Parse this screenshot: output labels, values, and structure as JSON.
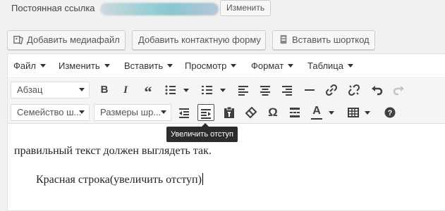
{
  "permalink": {
    "label": "Постоянная ссылка",
    "edit_button": "Изменить"
  },
  "media_buttons": [
    {
      "label": "Добавить медиафайл",
      "icon": "media-icon"
    },
    {
      "label": "Добавить контактную форму",
      "icon": "none"
    },
    {
      "label": "Вставить шорткод",
      "icon": "shortcode-icon"
    }
  ],
  "menubar": [
    "Файл",
    "Изменить",
    "Вставить",
    "Просмотр",
    "Формат",
    "Таблица"
  ],
  "toolbar1": {
    "format_select": "Абзац",
    "buttons": [
      "bold",
      "italic",
      "blockquote",
      "bullet-list",
      "numbered-list",
      "align-left",
      "align-center",
      "align-right",
      "horizontal-line",
      "insert-link",
      "remove-link",
      "undo",
      "redo"
    ]
  },
  "toolbar2": {
    "font_family_select": "Семейство ш...",
    "font_size_select": "Размеры шр...",
    "buttons": [
      "outdent",
      "indent",
      "paste-as-text",
      "clear-formatting",
      "special-character",
      "read-more",
      "text-color",
      "table",
      "help"
    ],
    "active_button": "indent"
  },
  "tooltip": "Увеличить отступ",
  "content": {
    "paragraph1": "правильный текст должен выглядеть так.",
    "paragraph2": "Красная строка(увеличить отступ)"
  },
  "colors": {
    "accent_dark": "#2c2c2c",
    "toolbar_bg": "#f5f5f5"
  }
}
